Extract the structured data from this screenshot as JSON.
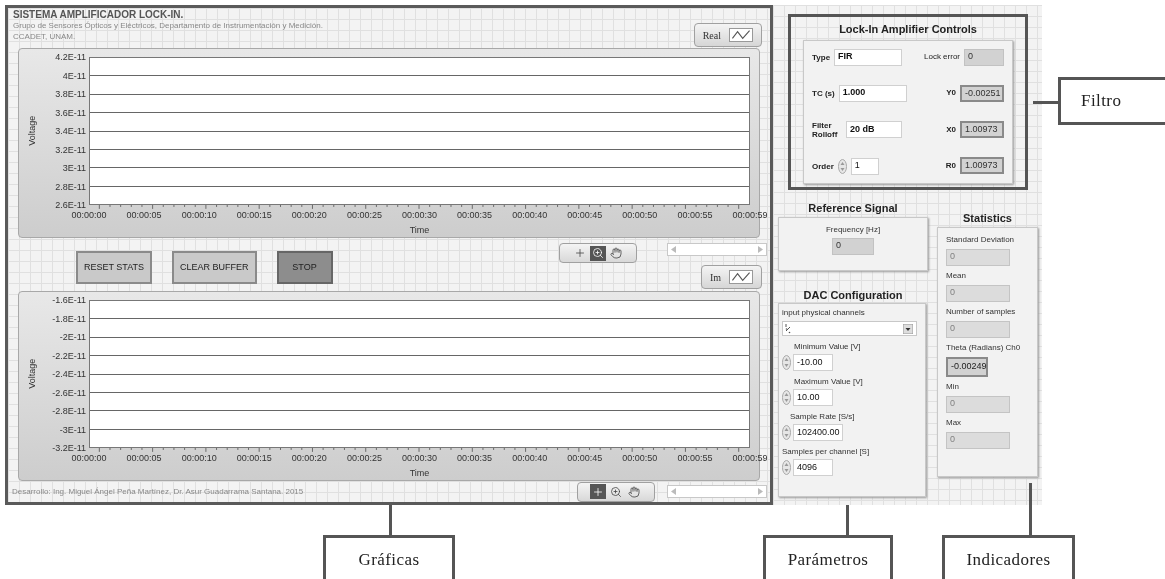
{
  "header": {
    "title": "SISTEMA AMPLIFICADOR LOCK-IN.",
    "subtitle": "Grupo de Sensores Ópticos y Eléctricos, Departamento de Instrumentación y Medición.",
    "institution": "CCADET, UNAM."
  },
  "graphs": [
    {
      "legend": "Real",
      "ylabel": "Voltage",
      "xlabel": "Time",
      "yticks": [
        "4.2E-11",
        "4E-11",
        "3.8E-11",
        "3.6E-11",
        "3.4E-11",
        "3.2E-11",
        "3E-11",
        "2.8E-11",
        "2.6E-11"
      ],
      "xticks": [
        "00:00:00",
        "00:00:05",
        "00:00:10",
        "00:00:15",
        "00:00:20",
        "00:00:25",
        "00:00:30",
        "00:00:35",
        "00:00:40",
        "00:00:45",
        "00:00:50",
        "00:00:55",
        "00:00:59"
      ],
      "tools": [
        {
          "kind": "cursor",
          "selected": false
        },
        {
          "kind": "zoom",
          "selected": true
        },
        {
          "kind": "pan",
          "selected": false
        }
      ]
    },
    {
      "legend": "Im",
      "ylabel": "Voltage",
      "xlabel": "Time",
      "yticks": [
        "-1.6E-11",
        "-1.8E-11",
        "-2E-11",
        "-2.2E-11",
        "-2.4E-11",
        "-2.6E-11",
        "-2.8E-11",
        "-3E-11",
        "-3.2E-11"
      ],
      "xticks": [
        "00:00:00",
        "00:00:05",
        "00:00:10",
        "00:00:15",
        "00:00:20",
        "00:00:25",
        "00:00:30",
        "00:00:35",
        "00:00:40",
        "00:00:45",
        "00:00:50",
        "00:00:55",
        "00:00:59"
      ],
      "tools": [
        {
          "kind": "cursor",
          "selected": true
        },
        {
          "kind": "zoom",
          "selected": false
        },
        {
          "kind": "pan",
          "selected": false
        }
      ]
    }
  ],
  "buttons": [
    {
      "label": "RESET STATS",
      "kind": "plain"
    },
    {
      "label": "CLEAR BUFFER",
      "kind": "plain"
    },
    {
      "label": "STOP",
      "kind": "stop"
    }
  ],
  "footer": "Desarrollo: Ing. Miguel Ángel Peña Martínez, Dr. Asur Guadarrama Santana. 2015",
  "lockin": {
    "title": "Lock-In Amplifier Controls",
    "controls": [
      {
        "label": "Type",
        "value": "FIR",
        "kind": "text"
      },
      {
        "label": "TC (s)",
        "value": "1.000",
        "kind": "text"
      },
      {
        "label": "Filter Rolloff",
        "value": "20 dB",
        "kind": "text"
      },
      {
        "label": "Order",
        "value": "1",
        "kind": "spin"
      }
    ],
    "indicators": [
      {
        "label": "Lock error",
        "value": "0",
        "kind": "flat"
      },
      {
        "label": "Y0",
        "value": "-0.00251",
        "kind": "sunken"
      },
      {
        "label": "X0",
        "value": "1.00973",
        "kind": "sunken"
      },
      {
        "label": "R0",
        "value": "1.00973",
        "kind": "sunken"
      }
    ]
  },
  "reference": {
    "title": "Reference Signal",
    "label": "Frequency [Hz]",
    "value": "0"
  },
  "dac": {
    "title": "DAC Configuration",
    "channel_label": "input physical channels",
    "controls": [
      {
        "label": "Minimum Value [V]",
        "value": "-10.00"
      },
      {
        "label": "Maximum Value [V]",
        "value": "10.00"
      },
      {
        "label": "Sample Rate [S/s]",
        "value": "102400.00"
      },
      {
        "label": "Samples per channel [S]",
        "value": "4096"
      }
    ]
  },
  "statistics": {
    "title": "Statistics",
    "items": [
      {
        "label": "Standard Deviation",
        "value": "0",
        "disabled": true
      },
      {
        "label": "Mean",
        "value": "0",
        "disabled": true
      },
      {
        "label": "Number of samples",
        "value": "0",
        "disabled": true
      },
      {
        "label": "Theta (Radians) Ch0",
        "value": "-0.00249",
        "disabled": false
      },
      {
        "label": "Min",
        "value": "0",
        "disabled": true
      },
      {
        "label": "Max",
        "value": "0",
        "disabled": true
      }
    ]
  },
  "callouts": {
    "filter": "Filtro",
    "graphs": "Gráficas",
    "parameters": "Parámetros",
    "indicators": "Indicadores"
  }
}
